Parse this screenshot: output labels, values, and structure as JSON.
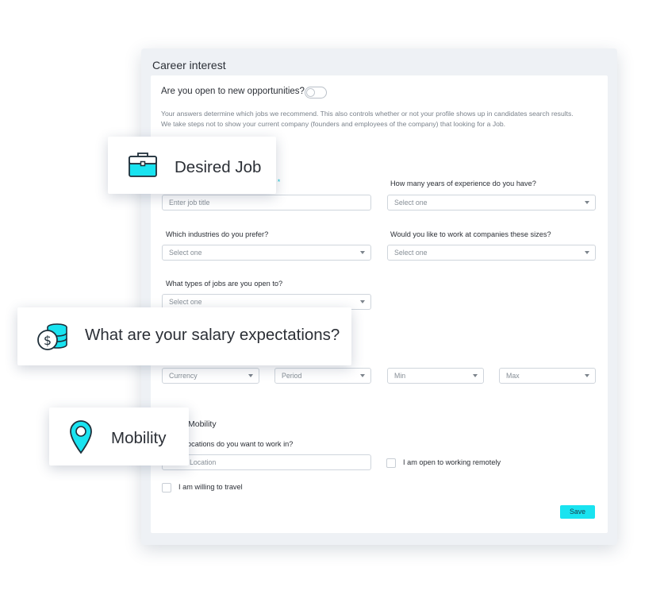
{
  "panel": {
    "title": "Career interest",
    "open_question": "Are you open to new opportunities?",
    "note_line1": "Your answers determine which jobs we recommend. This also controls whether or not your profile shows up in candidates search results.",
    "note_line2": "We take steps not to show your current company (founders and employees of the company) that looking for a Job.",
    "job_title_label_fragment": "o",
    "required_mark": "*",
    "job_title_placeholder": "Enter job title",
    "experience_label": "How many years of experience do you have?",
    "experience_value": "Select one",
    "industries_label": "Which industries do you prefer?",
    "industries_value": "Select one",
    "company_size_label": "Would you like to work at companies these sizes?",
    "company_size_value": "Select one",
    "job_types_label": "What types of jobs are you open to?",
    "job_types_value": "Select one",
    "currency_value": "Currency",
    "period_value": "Period",
    "min_value": "Min",
    "max_value": "Max",
    "mobility_heading_fragment": "Mobility",
    "locations_label_fragment": "locations do you want to work in?",
    "location_placeholder_fragment": "Location",
    "remote_label": "I am open to working remotely",
    "travel_label": "I am willing to travel",
    "save_label": "Save"
  },
  "callouts": {
    "desired_job": "Desired Job",
    "salary": "What are your salary expectations?",
    "mobility": "Mobility"
  },
  "colors": {
    "accent": "#19e3f0",
    "icon_stroke": "#1f2f3a"
  }
}
